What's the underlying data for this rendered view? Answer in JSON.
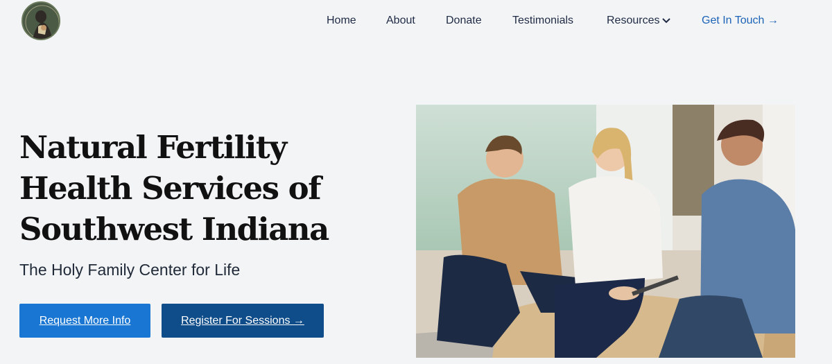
{
  "logo": {
    "icon": "holy-family-logo-icon",
    "colors": {
      "bg": "#4a5a45",
      "figure": "#2f2a26",
      "accent": "#d8c9a3"
    }
  },
  "nav": {
    "items": [
      {
        "label": "Home"
      },
      {
        "label": "About"
      },
      {
        "label": "Donate"
      },
      {
        "label": "Testimonials"
      },
      {
        "label": "Resources",
        "icon": "chevron-down-icon"
      }
    ],
    "cta": {
      "label": "Get In Touch →"
    }
  },
  "hero": {
    "title_lines": [
      "Natural Fertility",
      "Health Services of",
      "Southwest Indiana"
    ],
    "subtitle": "The Holy Family Center for Life",
    "buttons": {
      "primary": "Request More Info",
      "secondary": "Register For Sessions →"
    },
    "image": {
      "icon": "counseling-session-photo"
    }
  },
  "colors": {
    "background": "#f3f4f6",
    "primary_button": "#1976d2",
    "secondary_button": "#0f4c8a",
    "nav_text": "#1f2a44",
    "cta_text": "#1c63b7"
  }
}
